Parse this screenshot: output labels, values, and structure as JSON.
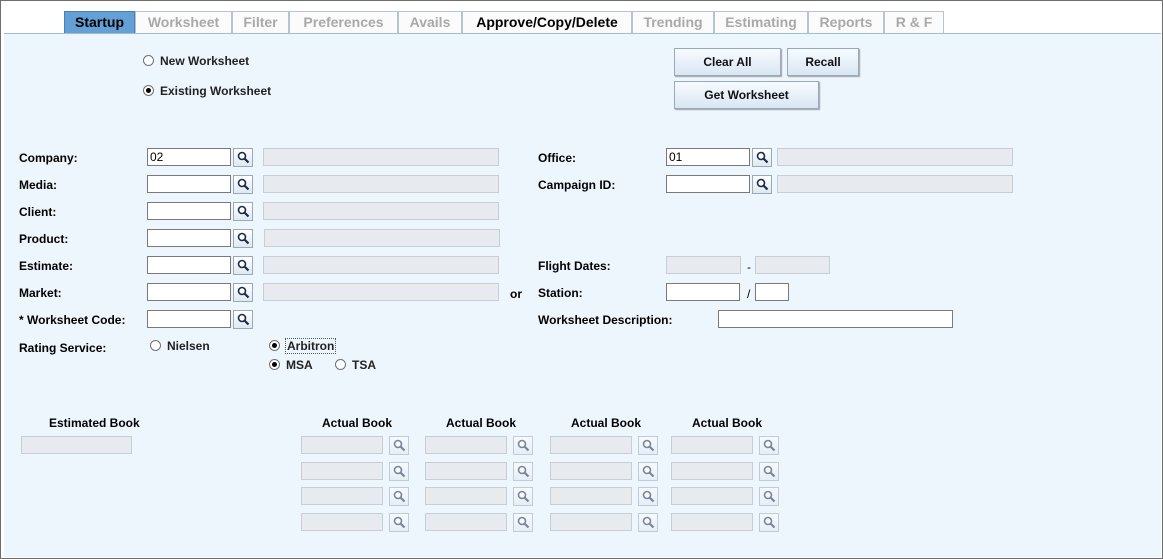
{
  "tabs": [
    {
      "label": "Startup",
      "state": "active"
    },
    {
      "label": "Worksheet",
      "state": "disabled"
    },
    {
      "label": "Filter",
      "state": "disabled"
    },
    {
      "label": "Preferences",
      "state": "disabled"
    },
    {
      "label": "Avails",
      "state": "disabled"
    },
    {
      "label": "Approve/Copy/Delete",
      "state": "enabled"
    },
    {
      "label": "Trending",
      "state": "disabled"
    },
    {
      "label": "Estimating",
      "state": "disabled"
    },
    {
      "label": "Reports",
      "state": "disabled"
    },
    {
      "label": "R & F",
      "state": "disabled"
    }
  ],
  "mode": {
    "new_label": "New Worksheet",
    "existing_label": "Existing Worksheet",
    "selected": "existing"
  },
  "buttons": {
    "clear_all": "Clear All",
    "recall": "Recall",
    "get_worksheet": "Get Worksheet"
  },
  "form": {
    "company": {
      "label": "Company:",
      "value": "02",
      "description": ""
    },
    "media": {
      "label": "Media:",
      "value": "",
      "description": ""
    },
    "client": {
      "label": "Client:",
      "value": "",
      "description": ""
    },
    "product": {
      "label": "Product:",
      "value": "",
      "description": ""
    },
    "estimate": {
      "label": "Estimate:",
      "value": "",
      "description": ""
    },
    "market": {
      "label": "Market:",
      "value": "",
      "description": ""
    },
    "or_label": "or",
    "worksheet_code": {
      "label": "* Worksheet Code:",
      "value": ""
    },
    "office": {
      "label": "Office:",
      "value": "01",
      "description": ""
    },
    "campaign_id": {
      "label": "Campaign ID:",
      "value": "",
      "description": ""
    },
    "flight_dates": {
      "label": "Flight Dates:",
      "start": "",
      "end": "",
      "separator": "-"
    },
    "station": {
      "label": "Station:",
      "value": "",
      "band": "",
      "separator": "/"
    },
    "worksheet_description": {
      "label": "Worksheet Description:",
      "value": ""
    }
  },
  "rating_service": {
    "label": "Rating Service:",
    "options": [
      "Nielsen",
      "Arbitron"
    ],
    "selected": "Arbitron",
    "area_options": [
      "MSA",
      "TSA"
    ],
    "area_selected": "MSA"
  },
  "books": {
    "estimated_label": "Estimated Book",
    "estimated_value": "",
    "actual_headers": [
      "Actual Book",
      "Actual Book",
      "Actual Book",
      "Actual Book"
    ],
    "actual_rows": 4
  },
  "icons": {
    "lookup": "magnifier-icon"
  }
}
